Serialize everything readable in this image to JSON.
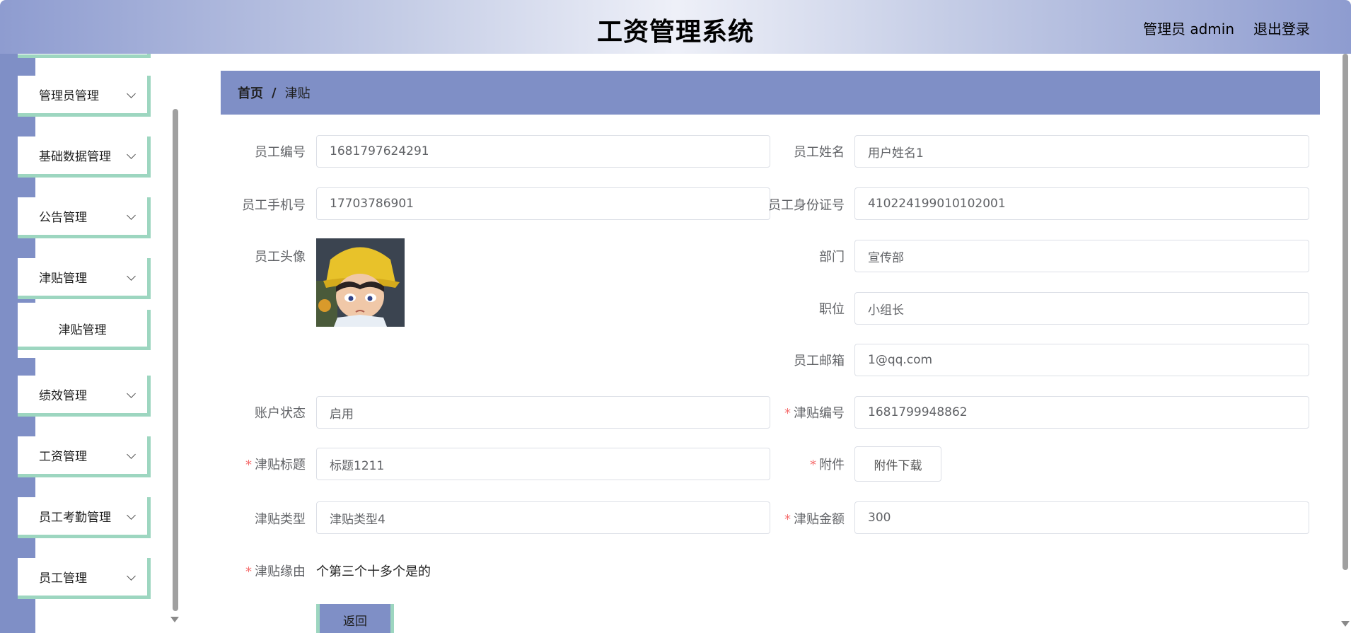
{
  "header": {
    "title": "工资管理系统",
    "user": "管理员 admin",
    "logout": "退出登录"
  },
  "sidebar": {
    "items": [
      {
        "label": "管理员管理"
      },
      {
        "label": "基础数据管理"
      },
      {
        "label": "公告管理"
      },
      {
        "label": "津贴管理"
      },
      {
        "label": "绩效管理"
      },
      {
        "label": "工资管理"
      },
      {
        "label": "员工考勤管理"
      },
      {
        "label": "员工管理"
      }
    ],
    "submenu": {
      "label": "津贴管理"
    }
  },
  "breadcrumb": {
    "home": "首页",
    "separator": "/",
    "current": "津贴"
  },
  "form": {
    "employee_no": {
      "label": "员工编号",
      "value": "1681797624291"
    },
    "employee_name": {
      "label": "员工姓名",
      "value": "用户姓名1"
    },
    "employee_phone": {
      "label": "员工手机号",
      "value": "17703786901"
    },
    "employee_id_card": {
      "label": "员工身份证号",
      "value": "410224199010102001"
    },
    "employee_avatar": {
      "label": "员工头像"
    },
    "department": {
      "label": "部门",
      "value": "宣传部"
    },
    "position": {
      "label": "职位",
      "value": "小组长"
    },
    "employee_email": {
      "label": "员工邮箱",
      "value": "1@qq.com"
    },
    "account_status": {
      "label": "账户状态",
      "value": "启用"
    },
    "allowance_no": {
      "label": "津贴编号",
      "value": "1681799948862",
      "required": "*"
    },
    "allowance_title": {
      "label": "津贴标题",
      "value": "标题1211",
      "required": "*"
    },
    "attachment": {
      "label": "附件",
      "button": "附件下载",
      "required": "*"
    },
    "allowance_type": {
      "label": "津贴类型",
      "value": "津贴类型4"
    },
    "allowance_amount": {
      "label": "津贴金额",
      "value": "300",
      "required": "*"
    },
    "allowance_reason": {
      "label": "津贴缘由",
      "value": "个第三个十多个是的",
      "required": "*"
    }
  },
  "actions": {
    "back": "返回"
  },
  "colors": {
    "accent": "#7f8fc6",
    "border_accent": "#9dd6c0",
    "required": "#f56c6c"
  }
}
